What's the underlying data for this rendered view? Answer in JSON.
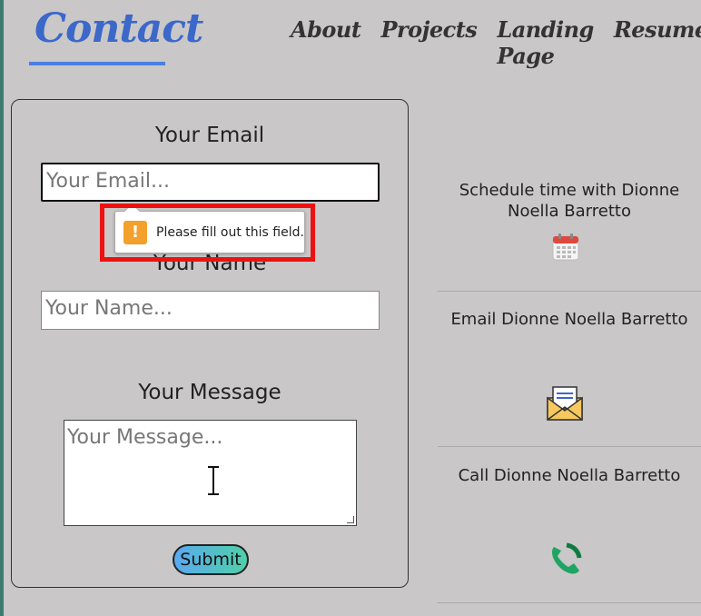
{
  "header": {
    "brand": "Contact",
    "nav": [
      "About",
      "Projects",
      "Landing Page",
      "Resume"
    ]
  },
  "form": {
    "email_label": "Your Email",
    "email_placeholder": "Your Email...",
    "name_label": "Your Name",
    "name_placeholder": "Your Name...",
    "message_label": "Your Message",
    "message_placeholder": "Your Message...",
    "submit_label": "Submit"
  },
  "validation": {
    "message": "Please fill out this field.",
    "icon": "!"
  },
  "contact": {
    "schedule": "Schedule time with Dionne Noella Barretto",
    "email": "Email Dionne Noella Barretto",
    "call": "Call Dionne Noella Barretto"
  },
  "colors": {
    "background": "#c9c7c8",
    "brand": "#3b68c9",
    "highlight": "#ee1111",
    "warning": "#f3a02c"
  }
}
